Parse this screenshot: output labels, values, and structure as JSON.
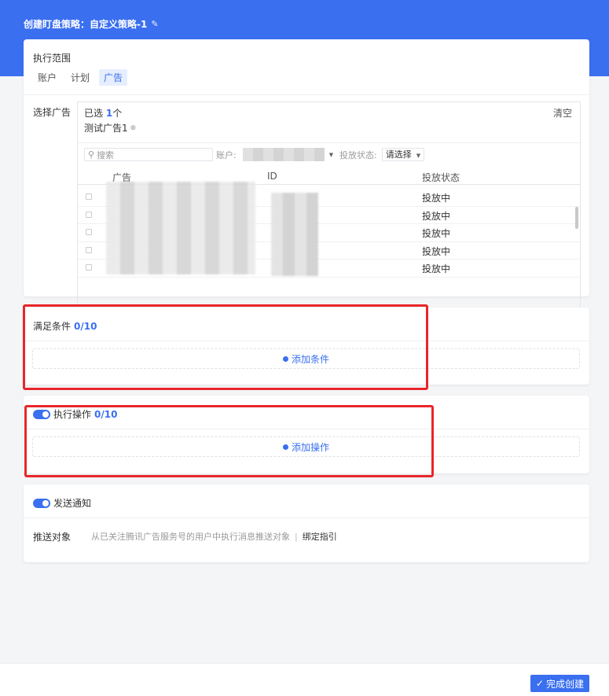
{
  "header": {
    "title": "创建盯盘策略：自定义策略-1",
    "edit_icon": "✎",
    "color": "#3a6ff0"
  },
  "scope": {
    "title": "执行范围",
    "tabs": [
      {
        "label": "账户"
      },
      {
        "label": "计划"
      },
      {
        "label": "广告"
      }
    ],
    "active_tab": "广告",
    "select_label": "选择广告",
    "selected_prefix": "已选 ",
    "selected_count": "1",
    "selected_suffix": "个",
    "clear_label": "清空",
    "chip_label": "测试广告1",
    "chip_close": "⊗",
    "search_placeholder": "搜索",
    "account_label": "账户:",
    "status_label": "投放状态:",
    "status_select": "请选择",
    "columns": [
      "广告",
      "ID",
      "投放状态"
    ],
    "rows": [
      {
        "status": "投放中"
      },
      {
        "status": "投放中"
      },
      {
        "status": "投放中"
      },
      {
        "status": "投放中"
      },
      {
        "status": "投放中"
      }
    ]
  },
  "conditions": {
    "title": "满足条件",
    "count": "0/10",
    "add_label": "添加条件"
  },
  "actions": {
    "title": "执行操作",
    "count": "0/10",
    "add_label": "添加操作"
  },
  "notify": {
    "title": "发送通知",
    "push_label": "推送对象",
    "push_text": "从已关注腾讯广告服务号的用户中执行消息推送对象",
    "separator": "|",
    "bind_label": "绑定指引"
  },
  "footer": {
    "done_icon": "✓",
    "done_label": "完成创建"
  }
}
